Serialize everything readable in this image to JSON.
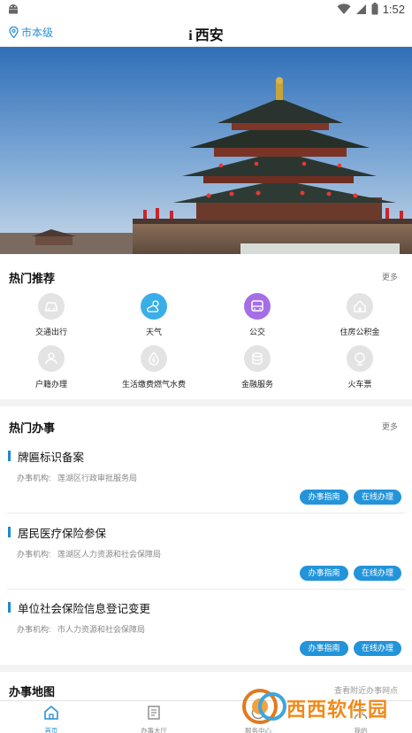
{
  "status_bar": {
    "time": "1:52"
  },
  "app_bar": {
    "location": "市本级",
    "title_prefix": "i",
    "title": "西安"
  },
  "hot_recommend": {
    "title": "热门推荐",
    "more": "更多",
    "items": [
      {
        "label": "交通出行",
        "icon": "car-icon",
        "style": "grey"
      },
      {
        "label": "天气",
        "icon": "weather-icon",
        "style": "blue"
      },
      {
        "label": "公交",
        "icon": "bus-icon",
        "style": "purple"
      },
      {
        "label": "住房公积金",
        "icon": "house-icon",
        "style": "grey"
      },
      {
        "label": "户籍办理",
        "icon": "id-card-icon",
        "style": "grey"
      },
      {
        "label": "生活缴费燃气水费",
        "icon": "utility-icon",
        "style": "grey"
      },
      {
        "label": "金融服务",
        "icon": "finance-icon",
        "style": "grey"
      },
      {
        "label": "火车票",
        "icon": "train-icon",
        "style": "grey"
      }
    ]
  },
  "hot_tasks": {
    "title": "热门办事",
    "more": "更多",
    "org_prefix": "办事机构:",
    "guide_label": "办事指南",
    "online_label": "在线办理",
    "items": [
      {
        "name": "牌匾标识备案",
        "org": "莲湖区行政审批服务局"
      },
      {
        "name": "居民医疗保险参保",
        "org": "莲湖区人力资源和社会保障局"
      },
      {
        "name": "单位社会保险信息登记变更",
        "org": "市人力资源和社会保障局"
      }
    ]
  },
  "task_map": {
    "title": "办事地图",
    "link": "查看附近办事网点"
  },
  "tab_bar": {
    "tabs": [
      {
        "label": "首页",
        "icon": "home-icon",
        "active": true
      },
      {
        "label": "办事大厅",
        "icon": "document-icon",
        "active": false
      },
      {
        "label": "服务中心",
        "icon": "service-icon",
        "active": false
      },
      {
        "label": "我的",
        "icon": "user-icon",
        "active": false
      }
    ]
  },
  "watermark": {
    "text": "西西软件园"
  },
  "colors": {
    "accent": "#2394d9",
    "weather": "#3aaee9",
    "bus": "#a56ee6"
  }
}
